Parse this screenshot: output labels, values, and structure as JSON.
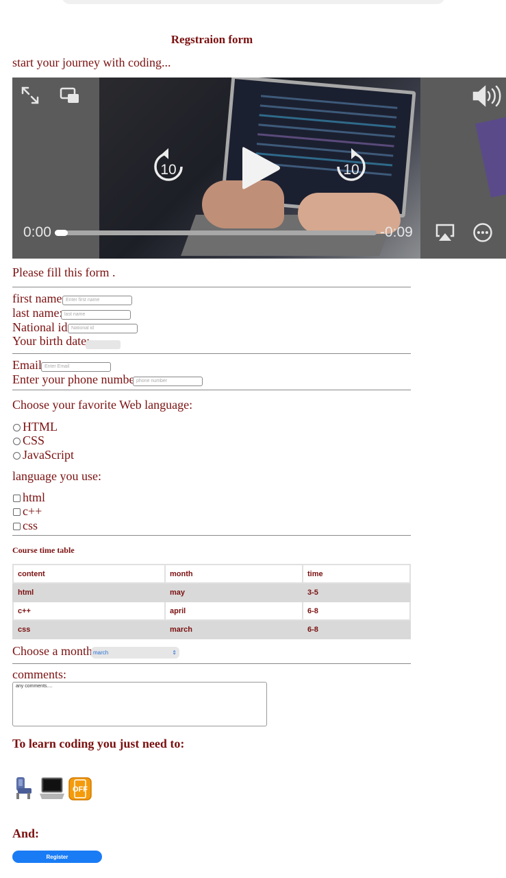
{
  "header": {
    "title": "Regstraion form",
    "subtitle": "start your journey with coding..."
  },
  "video": {
    "current_time": "0:00",
    "remaining_time": "-0:09",
    "progress_fraction": 0.04,
    "skip_back_seconds": "10",
    "skip_forward_seconds": "10"
  },
  "form": {
    "intro": "Please fill this form .",
    "first_name_label": "first name:",
    "first_name_placeholder": "Enter first name",
    "last_name_label": "last name:",
    "last_name_placeholder": "last name",
    "national_id_label": "National id:",
    "national_id_placeholder": "National id",
    "birth_date_label": "Your birth date:",
    "email_label": "Email",
    "email_placeholder": "Enter Email",
    "phone_label": "Enter your phone number:",
    "phone_placeholder": "phone number",
    "web_language_question": "Choose your favorite Web language:",
    "radio_options": [
      "HTML",
      "CSS",
      "JavaScript"
    ],
    "language_question": "language you use:",
    "checkbox_options": [
      "html",
      "c++",
      "css"
    ]
  },
  "timetable": {
    "caption": "Course time table",
    "headers": [
      "content",
      "month",
      "time"
    ],
    "rows": [
      [
        "html",
        "may",
        "3-5"
      ],
      [
        "c++",
        "april",
        "6-8"
      ],
      [
        "css",
        "march",
        "6-8"
      ]
    ]
  },
  "month_select": {
    "label": "Choose a month:",
    "selected": "march"
  },
  "comments": {
    "label": "comments:",
    "value": "any comments...."
  },
  "needs": {
    "heading": "To learn coding you just need to:",
    "icons": [
      "seat-icon",
      "laptop-icon",
      "phone-off-icon"
    ],
    "icon_off_text": "OFF"
  },
  "footer": {
    "and_label": "And:",
    "register_label": "Register"
  },
  "colors": {
    "text": "#7b1010",
    "button": "#1a7cf5"
  }
}
